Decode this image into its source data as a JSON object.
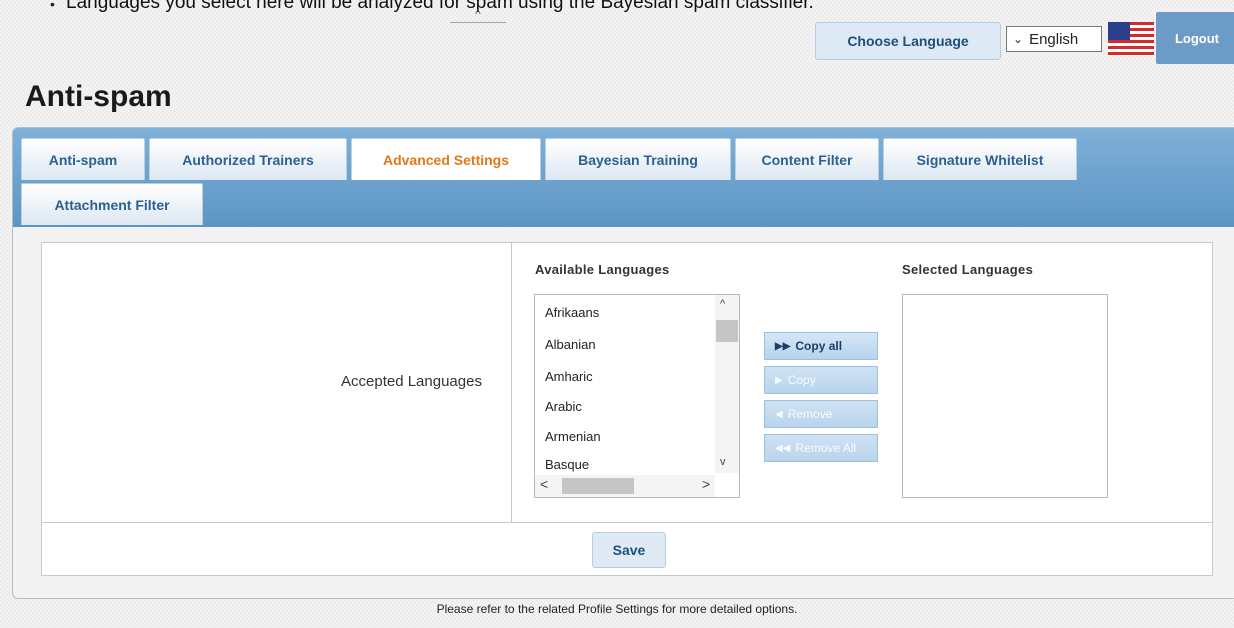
{
  "caption": "Languages you select here will be analyzed for spam using the Bayesian spam classifier.",
  "header": {
    "choose_language_label": "Choose Language",
    "language_select_value": "English",
    "logout_label": "Logout"
  },
  "page_title": "Anti-spam",
  "tabs": [
    {
      "label": "Anti-spam"
    },
    {
      "label": "Authorized Trainers"
    },
    {
      "label": "Advanced Settings",
      "active": true
    },
    {
      "label": "Bayesian Training"
    },
    {
      "label": "Content Filter"
    },
    {
      "label": "Signature Whitelist"
    },
    {
      "label": "Attachment Filter"
    }
  ],
  "form": {
    "accepted_label": "Accepted Languages",
    "available_heading": "Available Languages",
    "selected_heading": "Selected Languages",
    "available_languages": [
      "Afrikaans",
      "Albanian",
      "Amharic",
      "Arabic",
      "Armenian",
      "Basque"
    ],
    "selected_languages": [],
    "buttons": {
      "copy_all": "Copy all",
      "copy": "Copy",
      "remove": "Remove",
      "remove_all": "Remove All"
    },
    "save_label": "Save"
  },
  "footer_note": "Please refer to the related Profile Settings for more detailed options.",
  "colors": {
    "accent_blue": "#6c9bc8",
    "active_tab_text": "#e3781b",
    "tab_text": "#2d5f92"
  },
  "icons": {
    "flag": "us-flag-icon",
    "copy_all": "double-arrow-right-icon",
    "copy": "arrow-right-icon",
    "remove": "arrow-left-icon",
    "remove_all": "double-arrow-left-icon"
  }
}
